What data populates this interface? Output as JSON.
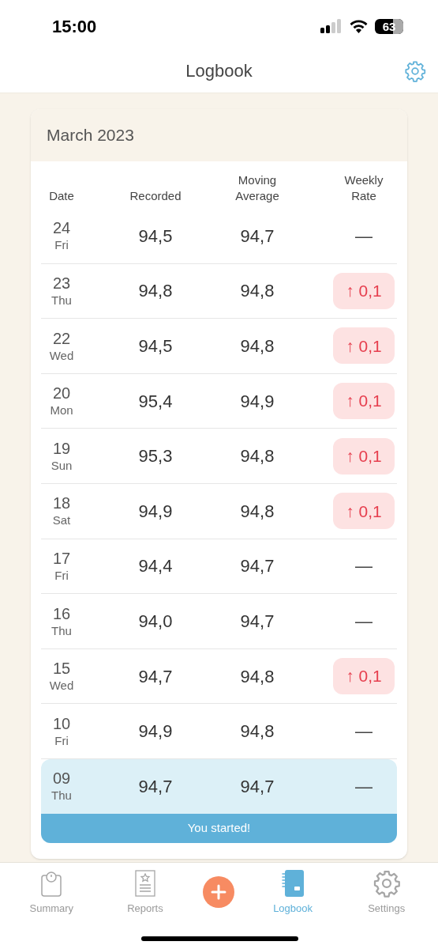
{
  "status_bar": {
    "time": "15:00",
    "battery": "63"
  },
  "header": {
    "title": "Logbook"
  },
  "month": "March 2023",
  "columns": [
    "Date",
    "Recorded",
    "Moving Average",
    "Weekly Rate"
  ],
  "rows": [
    {
      "day": "24",
      "weekday": "Fri",
      "recorded": "94,5",
      "average": "94,7",
      "rate": "—",
      "kind": "none"
    },
    {
      "day": "23",
      "weekday": "Thu",
      "recorded": "94,8",
      "average": "94,8",
      "rate": "↑ 0,1",
      "kind": "up"
    },
    {
      "day": "22",
      "weekday": "Wed",
      "recorded": "94,5",
      "average": "94,8",
      "rate": "↑ 0,1",
      "kind": "up"
    },
    {
      "day": "20",
      "weekday": "Mon",
      "recorded": "95,4",
      "average": "94,9",
      "rate": "↑ 0,1",
      "kind": "up"
    },
    {
      "day": "19",
      "weekday": "Sun",
      "recorded": "95,3",
      "average": "94,8",
      "rate": "↑ 0,1",
      "kind": "up"
    },
    {
      "day": "18",
      "weekday": "Sat",
      "recorded": "94,9",
      "average": "94,8",
      "rate": "↑ 0,1",
      "kind": "up"
    },
    {
      "day": "17",
      "weekday": "Fri",
      "recorded": "94,4",
      "average": "94,7",
      "rate": "—",
      "kind": "none"
    },
    {
      "day": "16",
      "weekday": "Thu",
      "recorded": "94,0",
      "average": "94,7",
      "rate": "—",
      "kind": "none"
    },
    {
      "day": "15",
      "weekday": "Wed",
      "recorded": "94,7",
      "average": "94,8",
      "rate": "↑ 0,1",
      "kind": "up"
    },
    {
      "day": "10",
      "weekday": "Fri",
      "recorded": "94,9",
      "average": "94,8",
      "rate": "—",
      "kind": "none"
    },
    {
      "day": "09",
      "weekday": "Thu",
      "recorded": "94,7",
      "average": "94,7",
      "rate": "—",
      "kind": "none",
      "banner": "You started!"
    }
  ],
  "nav": [
    {
      "kind": "tab",
      "label": "Summary",
      "selected": false
    },
    {
      "kind": "tab",
      "label": "Reports",
      "selected": false
    },
    {
      "kind": "add"
    },
    {
      "kind": "tab",
      "label": "Logbook",
      "selected": true
    },
    {
      "kind": "tab",
      "label": "Settings",
      "selected": false
    }
  ]
}
